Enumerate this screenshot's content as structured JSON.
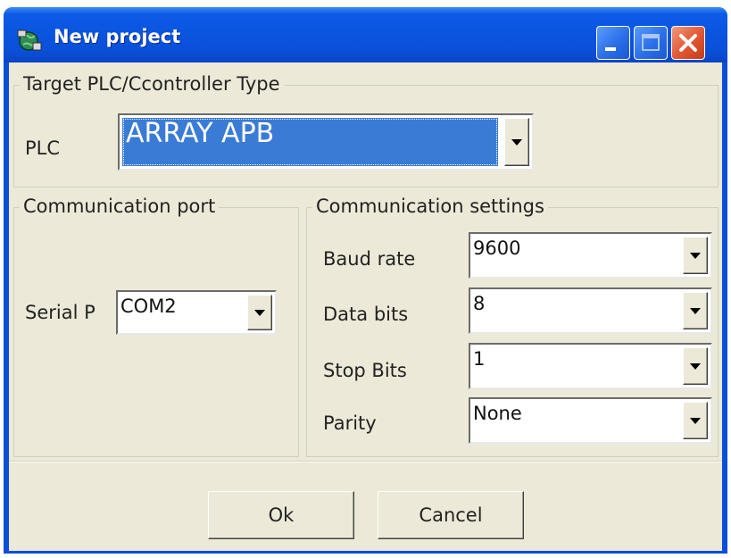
{
  "window": {
    "title": "New project"
  },
  "plc_group": {
    "label": "Target PLC/Ccontroller Type",
    "plc_label": "PLC",
    "plc_value": "ARRAY APB"
  },
  "port_group": {
    "label": "Communication port",
    "serial_label": "Serial P",
    "serial_value": "COM2"
  },
  "settings_group": {
    "label": "Communication settings",
    "baud_label": "Baud rate",
    "baud_value": "9600",
    "data_label": "Data bits",
    "data_value": "8",
    "stop_label": "Stop Bits",
    "stop_value": "1",
    "parity_label": "Parity",
    "parity_value": "None"
  },
  "buttons": {
    "ok": "Ok",
    "cancel": "Cancel"
  },
  "icons": {
    "app": "globe-app-icon",
    "minimize": "minimize-icon",
    "maximize": "maximize-icon",
    "close": "close-icon"
  },
  "colors": {
    "title_bar": "#0a55e0",
    "dialog_bg": "#ece9d8",
    "selection": "#3a7bd5",
    "close_button": "#e45a36"
  }
}
